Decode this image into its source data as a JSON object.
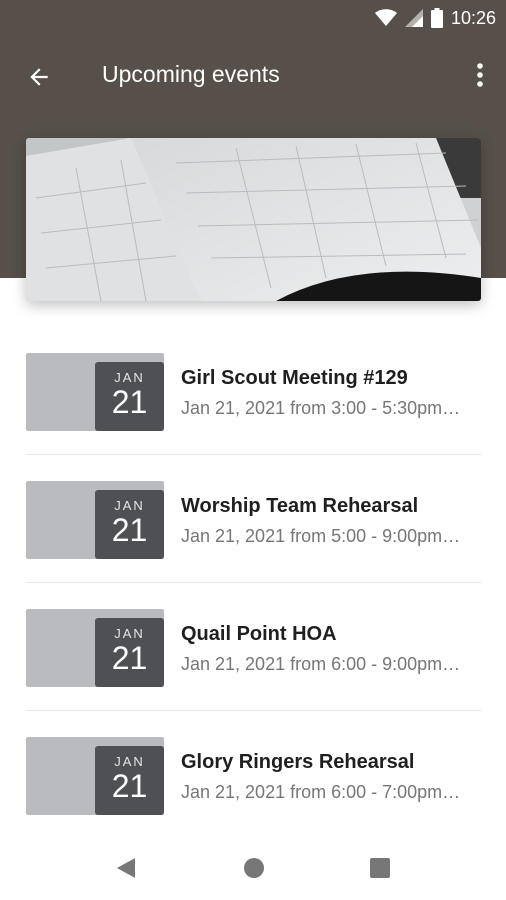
{
  "status_bar": {
    "time": "10:26",
    "icons": [
      "wifi-icon",
      "signal-icon",
      "battery-icon"
    ]
  },
  "app_bar": {
    "title": "Upcoming events",
    "back_icon": "arrow-left-icon",
    "more_icon": "more-vert-icon"
  },
  "colors": {
    "header_bg": "#57504a",
    "date_box": "#4e5054",
    "thumb": "#b9bbbe"
  },
  "events": [
    {
      "month": "JAN",
      "day": "21",
      "title": "Girl Scout Meeting #129",
      "subtitle": "Jan 21, 2021 from 3:00 - 5:30pm…"
    },
    {
      "month": "JAN",
      "day": "21",
      "title": "Worship Team Rehearsal",
      "subtitle": "Jan 21, 2021 from 5:00 - 9:00pm…"
    },
    {
      "month": "JAN",
      "day": "21",
      "title": "Quail Point HOA",
      "subtitle": "Jan 21, 2021 from 6:00 - 9:00pm…"
    },
    {
      "month": "JAN",
      "day": "21",
      "title": "Glory Ringers Rehearsal",
      "subtitle": "Jan 21, 2021 from 6:00 - 7:00pm…"
    }
  ],
  "nav_bar": {
    "icons": [
      "back-triangle-icon",
      "home-circle-icon",
      "recents-square-icon"
    ]
  }
}
